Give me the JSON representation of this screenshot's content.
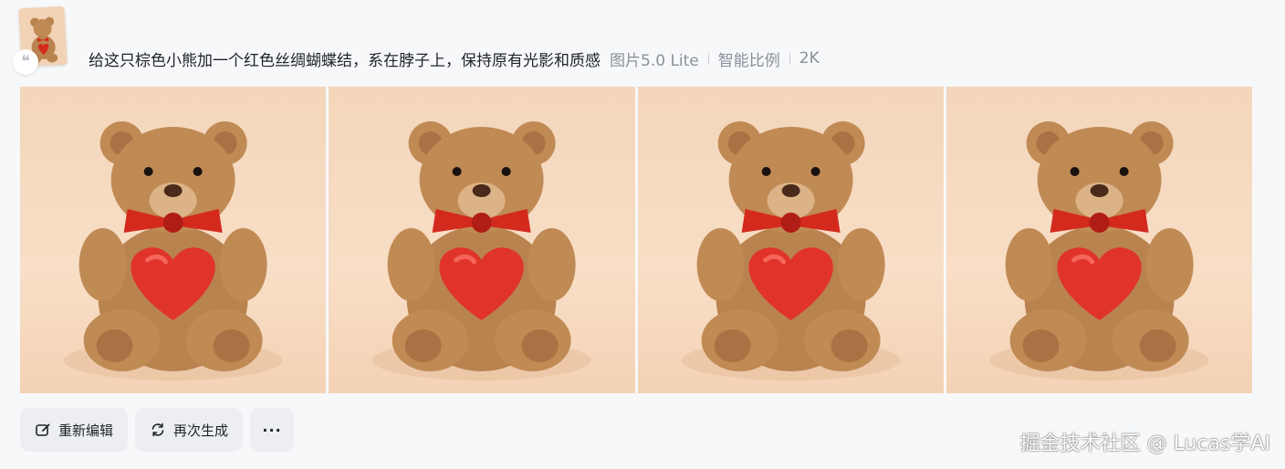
{
  "prompt": {
    "text": "给这只棕色小熊加一个红色丝绸蝴蝶结，系在脖子上，保持原有光影和质感",
    "model": "图片5.0 Lite",
    "ratio": "智能比例",
    "resolution": "2K"
  },
  "images": [
    {
      "icon": "teddy-bear-red-heart"
    },
    {
      "icon": "teddy-bear-red-heart"
    },
    {
      "icon": "teddy-bear-red-heart"
    },
    {
      "icon": "teddy-bear-red-heart"
    }
  ],
  "actions": {
    "reedit_label": "重新编辑",
    "regenerate_label": "再次生成",
    "more_label": "···"
  },
  "watermark": "掘金技术社区 @ Lucas学AI",
  "colors": {
    "background": "#f7f8fa",
    "button_bg": "#eceef1",
    "bear_fur": "#c08a54",
    "bow_red": "#d42a1e"
  }
}
